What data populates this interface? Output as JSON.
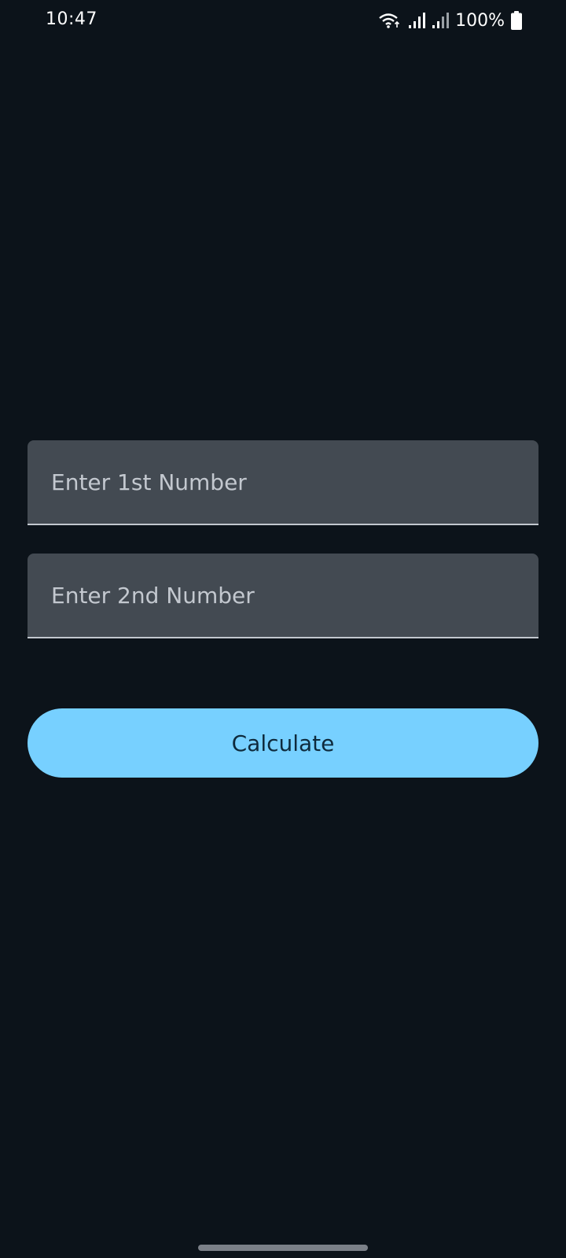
{
  "status_bar": {
    "time": "10:47",
    "battery_text": "100%",
    "icons": [
      "wifi-icon",
      "signal-icon",
      "signal-icon",
      "battery-icon"
    ]
  },
  "form": {
    "first_number": {
      "placeholder": "Enter 1st Number",
      "value": ""
    },
    "second_number": {
      "placeholder": "Enter 2nd Number",
      "value": ""
    },
    "calculate_label": "Calculate"
  },
  "colors": {
    "background": "#0c131a",
    "field_background": "#434a52",
    "field_underline": "#c2c7ce",
    "button_background": "#77d0ff",
    "button_text": "#0e2a3c"
  }
}
